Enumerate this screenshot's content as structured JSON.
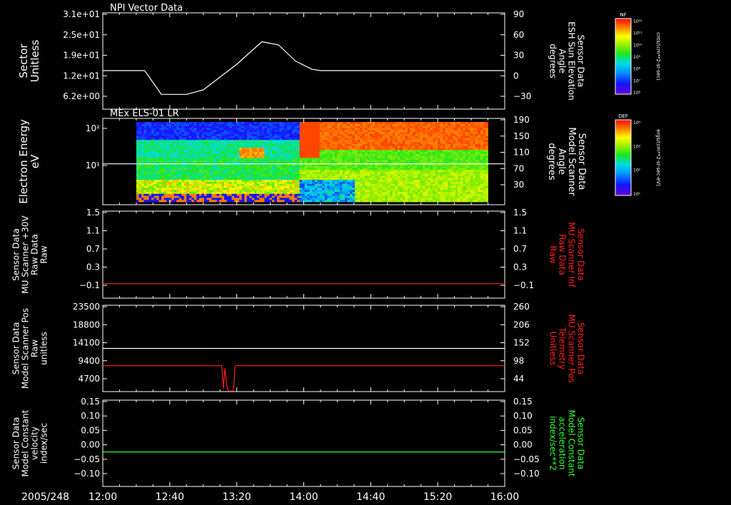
{
  "date_label": "2005/248",
  "x_axis": {
    "tick_labels": [
      "12:00",
      "12:40",
      "13:20",
      "14:00",
      "14:40",
      "15:20",
      "16:00"
    ]
  },
  "colors": {
    "foreground": "#ffffff",
    "red_trace": "#ff2020",
    "green_trace": "#33ff33",
    "background": "#000000"
  },
  "colorbars": [
    {
      "label": "NF",
      "unit": "cnts/(cm**2-sr-sec)",
      "tick_labels": [
        "10¹²",
        "10¹¹",
        "10¹⁰",
        "10⁹",
        "10⁸",
        "10⁷",
        "10⁶"
      ]
    },
    {
      "label": "DEF",
      "unit": "ergs/(cm**2-sr-sec-eV)",
      "tick_labels": [
        "10⁴",
        "10³",
        "10²",
        "10¹"
      ]
    }
  ],
  "chart_data": [
    {
      "type": "line",
      "title": "NPI Vector Data",
      "ylabel": [
        "Sector",
        "Unitless"
      ],
      "y_tick_labels": [
        "3.1e+01",
        "2.5e+01",
        "1.9e+01",
        "1.2e+01",
        "6.2e+00"
      ],
      "ylim": [
        0.0,
        31.0
      ],
      "right_ylabel": [
        "Sensor Data",
        "ESH Sun Elevation",
        "Angle",
        "degrees"
      ],
      "right_tick_labels": [
        "90",
        "60",
        "30",
        "0",
        "−30"
      ],
      "right_ylim": [
        -60,
        90
      ],
      "series": [
        {
          "color": "#ffffff",
          "axis": "right",
          "x": [
            "12:00",
            "12:25",
            "12:35",
            "12:50",
            "13:00",
            "13:20",
            "13:35",
            "13:45",
            "13:55",
            "14:05",
            "14:10",
            "16:00"
          ],
          "y": [
            0,
            0,
            -37,
            -37,
            -30,
            10,
            45,
            40,
            15,
            2,
            0,
            0
          ]
        }
      ]
    },
    {
      "type": "heatmap",
      "title": "MEx ELS-01 LR",
      "ylabel": [
        "Electron Energy",
        "eV"
      ],
      "y_tick_labels": [
        "10²",
        "10¹"
      ],
      "yscale": "log",
      "right_ylabel": [
        "Sensor Data",
        "Model Scanner",
        "Angle",
        "degrees"
      ],
      "right_tick_labels": [
        "190",
        "150",
        "110",
        "70",
        "30"
      ],
      "right_ylim": [
        0,
        190
      ],
      "x_range": [
        "12:20",
        "15:50"
      ],
      "series": [
        {
          "color": "#ffffff",
          "axis": "right",
          "x": [
            "12:00",
            "16:00"
          ],
          "y": [
            90,
            90
          ]
        }
      ]
    },
    {
      "type": "line",
      "ylabel": [
        "Sensor Data",
        "MU Scanner +30V",
        "Raw Data",
        "Raw"
      ],
      "y_tick_labels": [
        "1.5",
        "1.1",
        "0.7",
        "0.3",
        "−0.1"
      ],
      "ylim": [
        -0.3,
        1.5
      ],
      "right_ylabel": [
        "Sensor Data",
        "MU Scanner Inf",
        "Raw Data",
        "Raw"
      ],
      "right_tick_labels": [
        "1.5",
        "1.1",
        "0.7",
        "0.3",
        "−0.1"
      ],
      "right_ylim": [
        -0.3,
        1.5
      ],
      "series": [
        {
          "color": "#ff2020",
          "axis": "left",
          "x": [
            "12:00",
            "16:00"
          ],
          "y": [
            0.0,
            0.0
          ]
        }
      ]
    },
    {
      "type": "line",
      "ylabel": [
        "Sensor Data",
        "Model Scanner Pos",
        "Raw",
        "unitless"
      ],
      "y_tick_labels": [
        "23500",
        "18800",
        "14100",
        "9400",
        "4700"
      ],
      "ylim": [
        0,
        23500
      ],
      "right_ylabel": [
        "Sensor Data",
        "MU Scanner Pos",
        "Telemetry",
        "Unitless"
      ],
      "right_tick_labels": [
        "260",
        "206",
        "152",
        "98",
        "44"
      ],
      "right_ylim": [
        0,
        260
      ],
      "series": [
        {
          "color": "#ffffff",
          "axis": "left",
          "x": [
            "12:00",
            "16:00"
          ],
          "y": [
            11750,
            11750
          ]
        },
        {
          "color": "#ff2020",
          "axis": "right",
          "x": [
            "12:00",
            "13:11",
            "13:12",
            "13:13",
            "13:14",
            "13:15",
            "13:16",
            "13:17",
            "13:18",
            "13:19",
            "16:00"
          ],
          "y": [
            78,
            78,
            10,
            70,
            20,
            2,
            2,
            2,
            2,
            78,
            78
          ]
        }
      ]
    },
    {
      "type": "line",
      "ylabel": [
        "Sensor Data",
        "Model Constant",
        "velocity",
        "index/sec"
      ],
      "y_tick_labels": [
        "0.15",
        "0.10",
        "0.05",
        "0.00",
        "−0.05",
        "−0.10"
      ],
      "ylim": [
        -0.1,
        0.15
      ],
      "right_ylabel": [
        "Sensor Data",
        "Model Constant",
        "acceleration",
        "index/sec**2"
      ],
      "right_tick_labels": [
        "0.15",
        "0.10",
        "0.05",
        "0.00",
        "−0.05",
        "−0.10"
      ],
      "right_ylim": [
        -0.1,
        0.15
      ],
      "series": [
        {
          "color": "#33ff33",
          "axis": "left",
          "x": [
            "12:00",
            "16:00"
          ],
          "y": [
            0.0,
            0.0
          ]
        }
      ]
    }
  ]
}
